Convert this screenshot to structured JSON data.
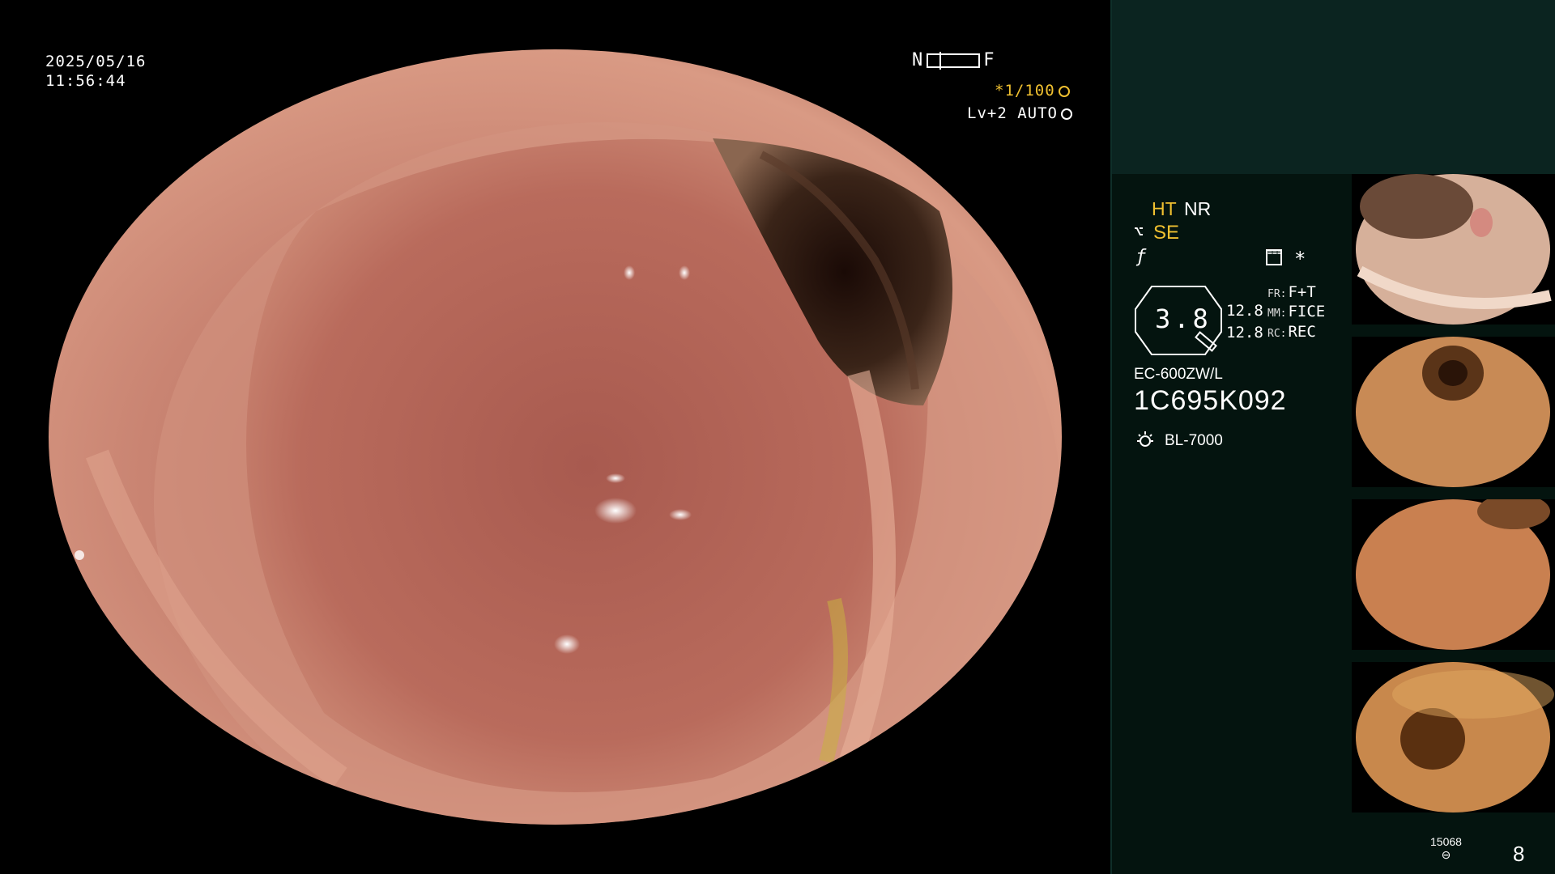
{
  "overlay": {
    "date": "2025/05/16",
    "time": "11:56:44",
    "near_label": "N",
    "far_label": "F",
    "shutter": "*1/100",
    "iris": "Lv+2 AUTO"
  },
  "panel": {
    "ht": "HT",
    "nr": "NR",
    "se": "SE",
    "star": "*",
    "zoom": "3.8",
    "value_1": "12.8",
    "value_2": "12.8",
    "fr_label": "FR:",
    "fr_value": "F+T",
    "mm_label": "MM:",
    "mm_value": "FICE",
    "rc_label": "RC:",
    "rc_value": "REC",
    "scope_model": "EC-600ZW/L",
    "serial": "1C695K092",
    "light_source": "BL-7000",
    "capture_count": "15068",
    "page_number": "8"
  },
  "colors": {
    "panel_bg": "#04140f",
    "panel_top": "#0b2420",
    "highlight": "#f0c030",
    "mucosa": "#c9826e"
  },
  "icons": {
    "se": "edge-enhance-icon",
    "sharp": "sharpness-icon",
    "mode": "structure-mode-icon",
    "shutter": "aperture-icon",
    "iris": "iris-icon",
    "light": "light-source-icon",
    "counter": "storage-counter-icon"
  }
}
